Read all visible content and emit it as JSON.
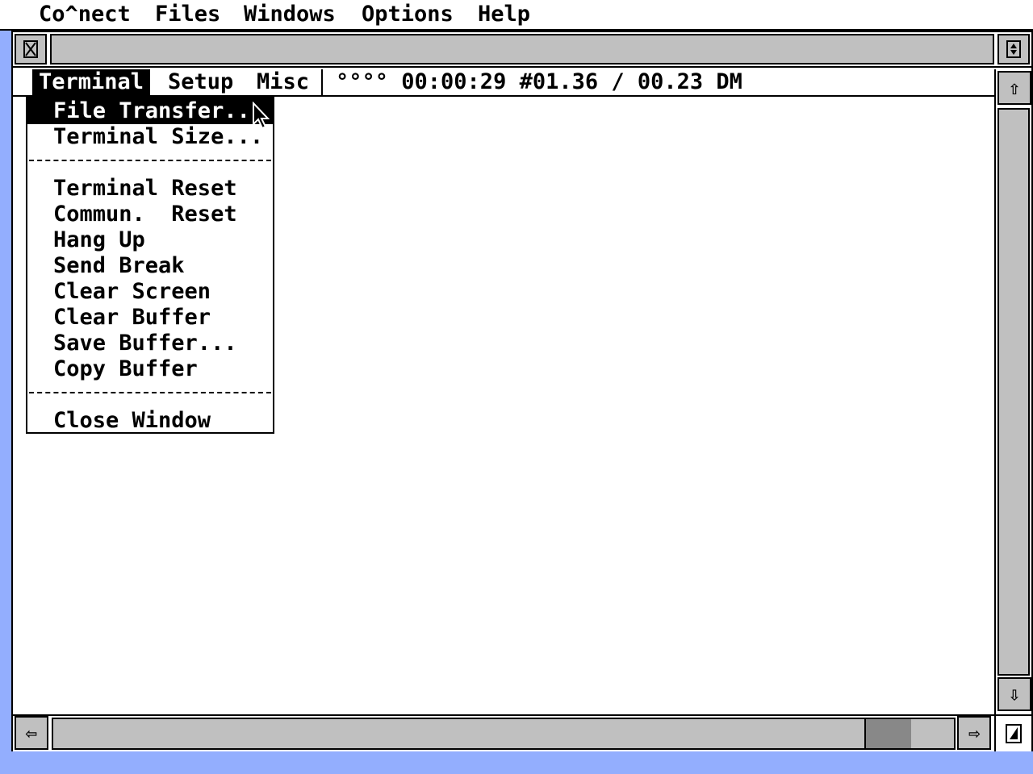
{
  "desktop_menu": {
    "items": [
      "Co^nect",
      "Files",
      "Windows",
      "Options",
      "Help"
    ]
  },
  "window": {
    "close_icon": "close-box-icon",
    "full_icon": "fuller-box-icon"
  },
  "terminal_menu": {
    "items": [
      "Terminal",
      "Setup",
      "Misc"
    ],
    "active": "Terminal",
    "status": "°°°° 00:00:29 #01.36 / 00.23 DM"
  },
  "dropdown": {
    "group1": [
      "File Transfer...",
      "Terminal Size..."
    ],
    "group2": [
      "Terminal Reset",
      "Commun.  Reset",
      "Hang Up",
      "Send Break",
      "Clear Screen",
      "Clear Buffer",
      "Save Buffer...",
      "Copy Buffer"
    ],
    "group3": [
      "Close Window"
    ],
    "highlighted": "File Transfer..."
  },
  "scrollbars": {
    "up_icon": "⇧",
    "down_icon": "⇩",
    "left_icon": "⇦",
    "right_icon": "⇨",
    "horizontal_thumb_position": 0.95
  },
  "colors": {
    "desktop": "#93aefe",
    "scroll_track": "#c0c0c0",
    "scroll_thumb": "#888888"
  }
}
